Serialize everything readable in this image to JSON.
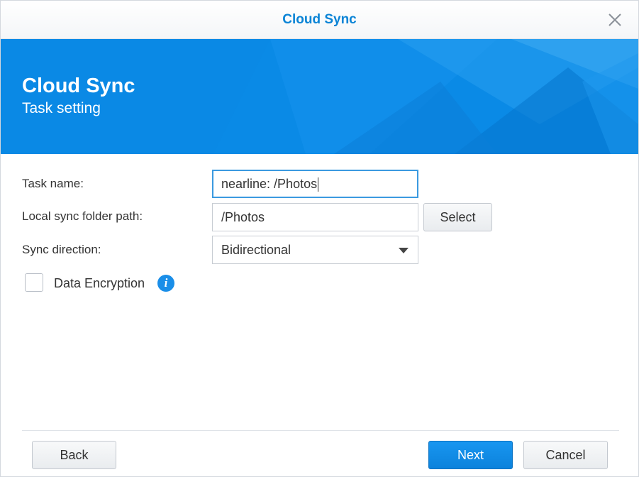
{
  "window": {
    "title": "Cloud Sync"
  },
  "banner": {
    "heading": "Cloud Sync",
    "subheading": "Task setting"
  },
  "form": {
    "task_name": {
      "label": "Task name:",
      "value": "nearline: /Photos"
    },
    "local_path": {
      "label": "Local sync folder path:",
      "value": "/Photos",
      "button_label": "Select"
    },
    "sync_direction": {
      "label": "Sync direction:",
      "selected": "Bidirectional"
    },
    "encryption": {
      "label": "Data Encryption",
      "checked": false
    }
  },
  "footer": {
    "back_label": "Back",
    "next_label": "Next",
    "cancel_label": "Cancel"
  },
  "colors": {
    "accent": "#0b84d6",
    "banner": "#0a8ae6",
    "primary_button": "#1590ec"
  },
  "icons": {
    "close": "close-icon",
    "info": "info-icon",
    "dropdown": "chevron-down-icon"
  }
}
